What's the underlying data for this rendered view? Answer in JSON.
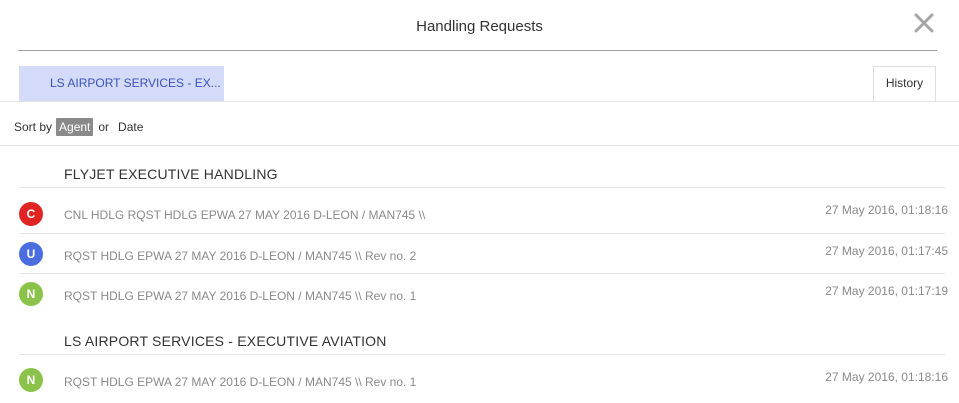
{
  "dialog": {
    "title": "Handling Requests"
  },
  "tabs": {
    "agent_tab": "LS AIRPORT SERVICES - EX...",
    "history_tab": "History"
  },
  "sort": {
    "label": "Sort by",
    "agent": "Agent",
    "or": "or",
    "date": "Date",
    "active": "Agent"
  },
  "groups": [
    {
      "name": "FLYJET EXECUTIVE HANDLING",
      "items": [
        {
          "badge": "C",
          "badge_color": "#e02424",
          "message": "CNL HDLG RQST HDLG EPWA 27 MAY 2016 D-LEON / MAN745 \\\\",
          "timestamp": "27 May 2016, 01:18:16"
        },
        {
          "badge": "U",
          "badge_color": "#4a6ee0",
          "message": "RQST HDLG EPWA 27 MAY 2016 D-LEON / MAN745 \\\\ Rev no. 2",
          "timestamp": "27 May 2016, 01:17:45"
        },
        {
          "badge": "N",
          "badge_color": "#8bc34a",
          "message": "RQST HDLG EPWA 27 MAY 2016 D-LEON / MAN745 \\\\ Rev no. 1",
          "timestamp": "27 May 2016, 01:17:19"
        }
      ]
    },
    {
      "name": "LS AIRPORT SERVICES - EXECUTIVE AVIATION",
      "items": [
        {
          "badge": "N",
          "badge_color": "#8bc34a",
          "message": "RQST HDLG EPWA 27 MAY 2016 D-LEON / MAN745 \\\\ Rev no. 1",
          "timestamp": "27 May 2016, 01:18:16"
        }
      ]
    }
  ]
}
